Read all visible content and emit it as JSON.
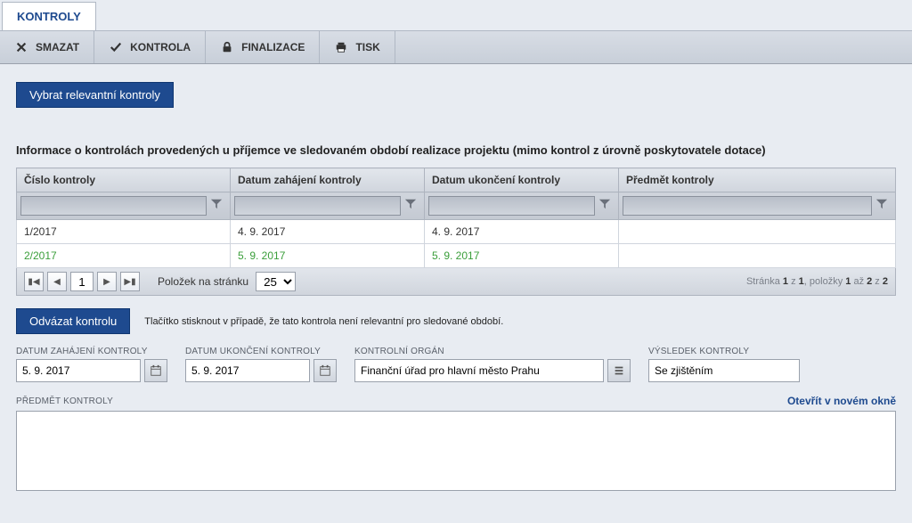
{
  "tab": {
    "label": "KONTROLY"
  },
  "toolbar": {
    "smazat": "SMAZAT",
    "kontrola": "KONTROLA",
    "finalizace": "FINALIZACE",
    "tisk": "TISK"
  },
  "buttons": {
    "vybrat": "Vybrat relevantní kontroly",
    "odvazat": "Odvázat kontrolu"
  },
  "section_title": "Informace o kontrolách provedených u příjemce ve sledovaném období realizace projektu (mimo kontrol z úrovně poskytovatele dotace)",
  "table": {
    "headers": {
      "cislo": "Číslo kontroly",
      "datum_zahajeni": "Datum zahájení kontroly",
      "datum_ukonceni": "Datum ukončení kontroly",
      "predmet": "Předmět kontroly"
    },
    "rows": [
      {
        "cislo": "1/2017",
        "datum_zahajeni": "4. 9. 2017",
        "datum_ukonceni": "4. 9. 2017",
        "predmet": ""
      },
      {
        "cislo": "2/2017",
        "datum_zahajeni": "5. 9. 2017",
        "datum_ukonceni": "5. 9. 2017",
        "predmet": ""
      }
    ],
    "footer": {
      "per_page_label": "Položek na stránku",
      "per_page_value": "25",
      "page_value": "1",
      "info_prefix": "Stránka ",
      "info_page_cur": "1",
      "info_z": " z ",
      "info_page_tot": "1",
      "info_items": ", položky ",
      "info_item_from": "1",
      "info_az": " až ",
      "info_item_to": "2",
      "info_z2": " z ",
      "info_item_tot": "2"
    }
  },
  "hint": "Tlačítko stisknout v případě, že tato kontrola není relevantní pro sledované období.",
  "form": {
    "datum_zahajeni": {
      "label": "DATUM ZAHÁJENÍ KONTROLY",
      "value": "5. 9. 2017"
    },
    "datum_ukonceni": {
      "label": "DATUM UKONČENÍ KONTROLY",
      "value": "5. 9. 2017"
    },
    "kontrolni_organ": {
      "label": "KONTROLNÍ ORGÁN",
      "value": "Finanční úřad pro hlavní město Prahu"
    },
    "vysledek": {
      "label": "VÝSLEDEK KONTROLY",
      "value": "Se zjištěním"
    },
    "predmet": {
      "label": "PŘEDMĚT KONTROLY",
      "value": ""
    },
    "open_new": "Otevřít v novém okně"
  }
}
